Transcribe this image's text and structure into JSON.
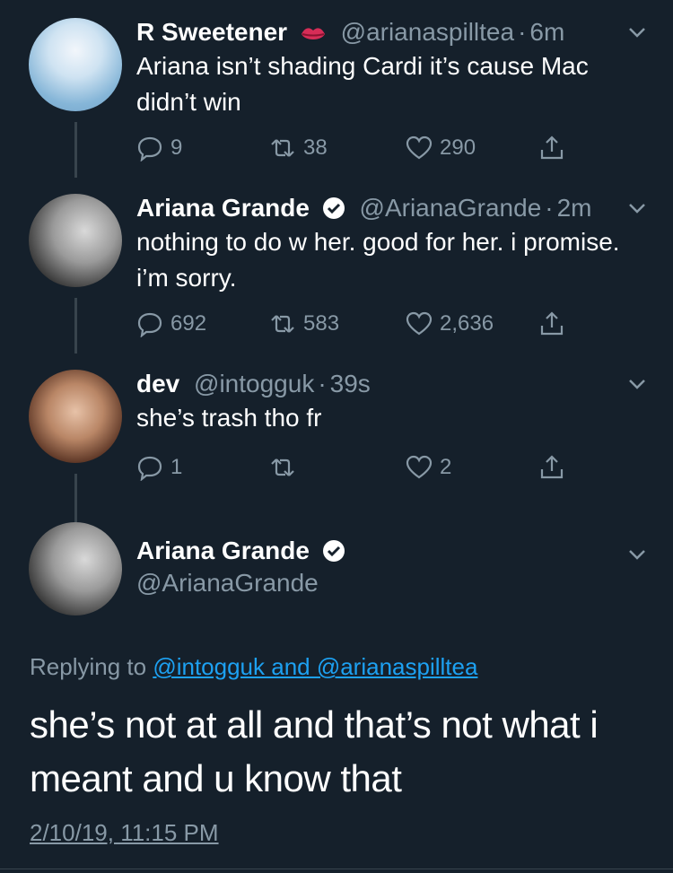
{
  "tweets": [
    {
      "name": "R Sweetener",
      "badge_icon": "lips-icon",
      "handle": "@arianaspilltea",
      "dot": "·",
      "time": "6m",
      "text": "Ariana isn’t shading Cardi it’s cause Mac didn’t win",
      "replies": "9",
      "retweets": "38",
      "likes": "290"
    },
    {
      "name": "Ariana Grande",
      "badge_icon": "verified-icon",
      "handle": "@ArianaGrande",
      "dot": "·",
      "time": "2m",
      "text": "nothing to do w her. good for her. i promise. i’m sorry.",
      "replies": "692",
      "retweets": "583",
      "likes": "2,636"
    },
    {
      "name": "dev",
      "handle": "@intogguk",
      "dot": "·",
      "time": "39s",
      "text": "she’s trash tho fr",
      "replies": "1",
      "retweets": "",
      "likes": "2"
    }
  ],
  "main": {
    "name": "Ariana Grande",
    "badge_icon": "verified-icon",
    "handle": "@ArianaGrande",
    "replying_prefix": "Replying to ",
    "replying_to": "@intogguk and @arianaspilltea",
    "text": "she’s not at all and that’s not what i meant and u know that",
    "timestamp": "2/10/19, 11:15 PM"
  },
  "colors": {
    "background": "#15202b",
    "muted": "#8899a6",
    "link": "#1da1f2",
    "line": "#38444d"
  }
}
